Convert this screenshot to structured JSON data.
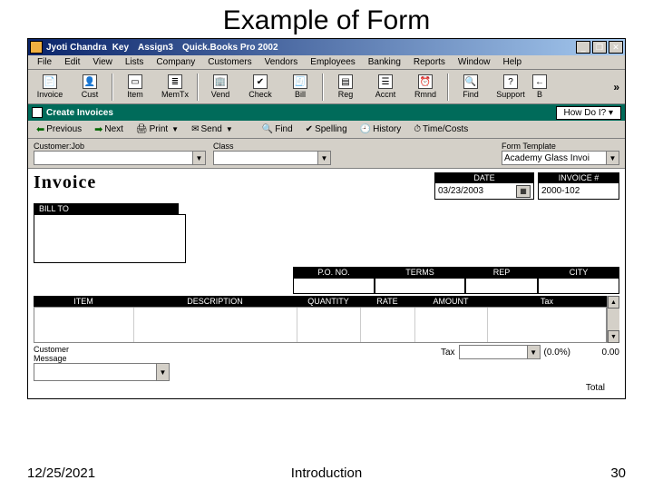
{
  "slide": {
    "title": "Example of Form",
    "footer_date": "12/25/2021",
    "footer_center": "Introduction",
    "page_number": "30"
  },
  "window": {
    "title_user": "Jyoti Chandra",
    "title_key": "Key",
    "title_assign": "Assign3",
    "title_app": "Quick.Books Pro 2002"
  },
  "menu": {
    "file": "File",
    "edit": "Edit",
    "view": "View",
    "lists": "Lists",
    "company": "Company",
    "customers": "Customers",
    "vendors": "Vendors",
    "employees": "Employees",
    "banking": "Banking",
    "reports": "Reports",
    "window": "Window",
    "help": "Help"
  },
  "toolbar": {
    "invoice": "Invoice",
    "cust": "Cust",
    "item": "Item",
    "memtx": "MemTx",
    "vend": "Vend",
    "check": "Check",
    "bill": "Bill",
    "reg": "Reg",
    "accnt": "Accnt",
    "rmnd": "Rmnd",
    "find": "Find",
    "support": "Support",
    "b": "B",
    "chevron": "»"
  },
  "subwin": {
    "title": "Create Invoices",
    "howdoi": "How Do I?"
  },
  "nav": {
    "previous": "Previous",
    "next": "Next",
    "print": "Print",
    "send": "Send",
    "find": "Find",
    "spelling": "Spelling",
    "history": "History",
    "timecosts": "Time/Costs"
  },
  "meta": {
    "customer_label": "Customer:Job",
    "class_label": "Class",
    "template_label": "Form Template",
    "template_value": "Academy Glass Invoi"
  },
  "invoice": {
    "title": "Invoice",
    "date_label": "DATE",
    "date_value": "03/23/2003",
    "invno_label": "INVOICE #",
    "invno_value": "2000-102",
    "billto_label": "BILL TO",
    "pono_label": "P.O. NO.",
    "terms_label": "TERMS",
    "rep_label": "REP",
    "city_label": "CITY",
    "item_label": "ITEM",
    "desc_label": "DESCRIPTION",
    "qty_label": "QUANTITY",
    "rate_label": "RATE",
    "amount_label": "AMOUNT",
    "tax_col_label": "Tax",
    "cust_msg_label": "Customer\nMessage",
    "tax_label": "Tax",
    "tax_pct": "(0.0%)",
    "tax_amount": "0.00",
    "total_label": "Total"
  }
}
